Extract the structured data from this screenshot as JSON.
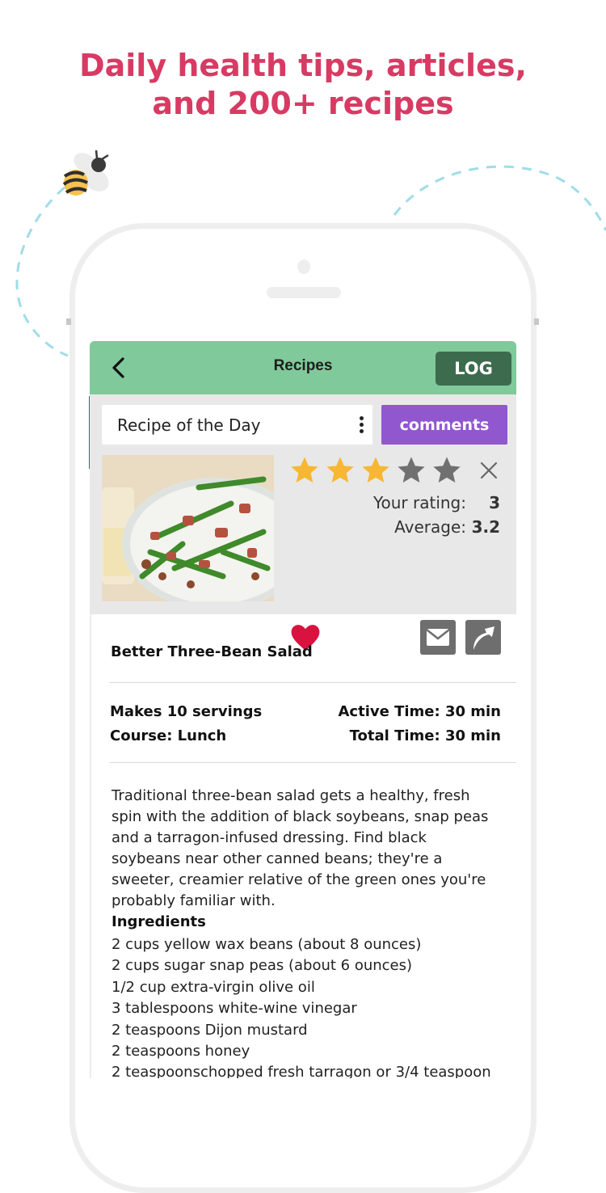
{
  "headline": {
    "line1": "Daily health tips, articles,",
    "line2": "and 200+ recipes"
  },
  "decorations": {
    "mascot": "bee-icon",
    "path_color": "#9fdde8"
  },
  "colors": {
    "headline": "#d83a63",
    "navbar": "#80c99a",
    "log_button": "#3d6b4e",
    "comments_button": "#9157cf",
    "star_filled": "#f7b733",
    "star_empty": "#707070",
    "heart": "#d9123f"
  },
  "navbar": {
    "back_icon": "chevron-left-icon",
    "title": "Recipes",
    "log_label": "LOG"
  },
  "recipe_header": {
    "selector_label": "Recipe of the Day",
    "menu_icon": "kebab-menu-icon",
    "comments_label": "comments"
  },
  "rating": {
    "max_stars": 5,
    "user_stars": 3,
    "your_rating_label": "Your rating:",
    "your_rating_value": "3",
    "average_label": "Average:",
    "average_value": "3.2",
    "clear_icon": "close-icon"
  },
  "actions": {
    "favorite_icon": "heart-icon",
    "email_icon": "envelope-icon",
    "share_icon": "share-arrow-icon"
  },
  "recipe": {
    "title": "Better Three-Bean Salad",
    "servings": "Makes 10 servings",
    "course": "Course: Lunch",
    "active_time": "Active Time: 30 min",
    "total_time": "Total Time: 30 min",
    "description": "Traditional three-bean salad gets a healthy, fresh spin with the addition of black soybeans, snap peas and a tarragon-infused dressing. Find black soybeans near other canned beans; they're a sweeter, creamier relative of the green ones you're probably familiar with.",
    "ingredients_heading": "Ingredients",
    "ingredients": [
      "2 cups yellow wax beans (about 8 ounces)",
      "2 cups sugar snap peas (about 6 ounces)",
      "1/2 cup extra-virgin olive oil",
      "3 tablespoons white-wine vinegar",
      "2 teaspoons Dijon mustard",
      "2 teaspoons honey",
      "2 teaspoonschopped fresh tarragon or 3/4 teaspoon"
    ]
  }
}
